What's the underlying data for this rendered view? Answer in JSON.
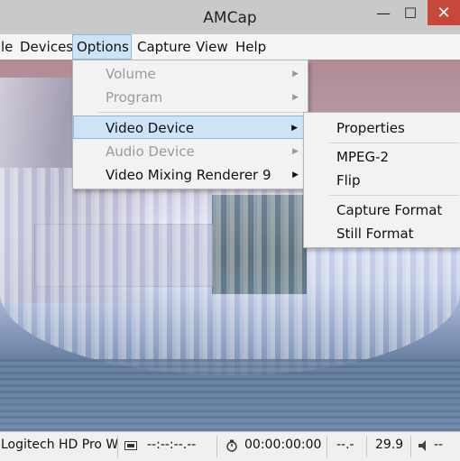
{
  "window": {
    "title": "AMCap",
    "minimize_glyph": "—",
    "maximize_glyph": "☐",
    "close_glyph": "✕"
  },
  "menubar": {
    "items": [
      "le",
      "Devices",
      "Options",
      "Capture",
      "View",
      "Help"
    ],
    "active": "Options"
  },
  "options_menu": {
    "items": [
      {
        "label": "Volume",
        "disabled": true,
        "submenu": true
      },
      {
        "label": "Program",
        "disabled": true,
        "submenu": true
      },
      {
        "label": "Video Device",
        "disabled": false,
        "submenu": true,
        "highlighted": true
      },
      {
        "label": "Audio Device",
        "disabled": true,
        "submenu": true
      },
      {
        "label": "Video Mixing Renderer 9",
        "disabled": false,
        "submenu": true
      }
    ]
  },
  "video_device_submenu": {
    "items": [
      "Properties",
      "MPEG-2",
      "Flip",
      "Capture Format",
      "Still Format"
    ]
  },
  "statusbar": {
    "device": "Logitech HD Pro W",
    "timestamp": "--:--:--.--",
    "timer": "00:00:00:00",
    "dropped": "--.-",
    "fps": "29.9",
    "audio": "--"
  },
  "submenu_arrow": "▶",
  "colors": {
    "highlight": "#cde4f7",
    "close_button": "#c7473b"
  }
}
